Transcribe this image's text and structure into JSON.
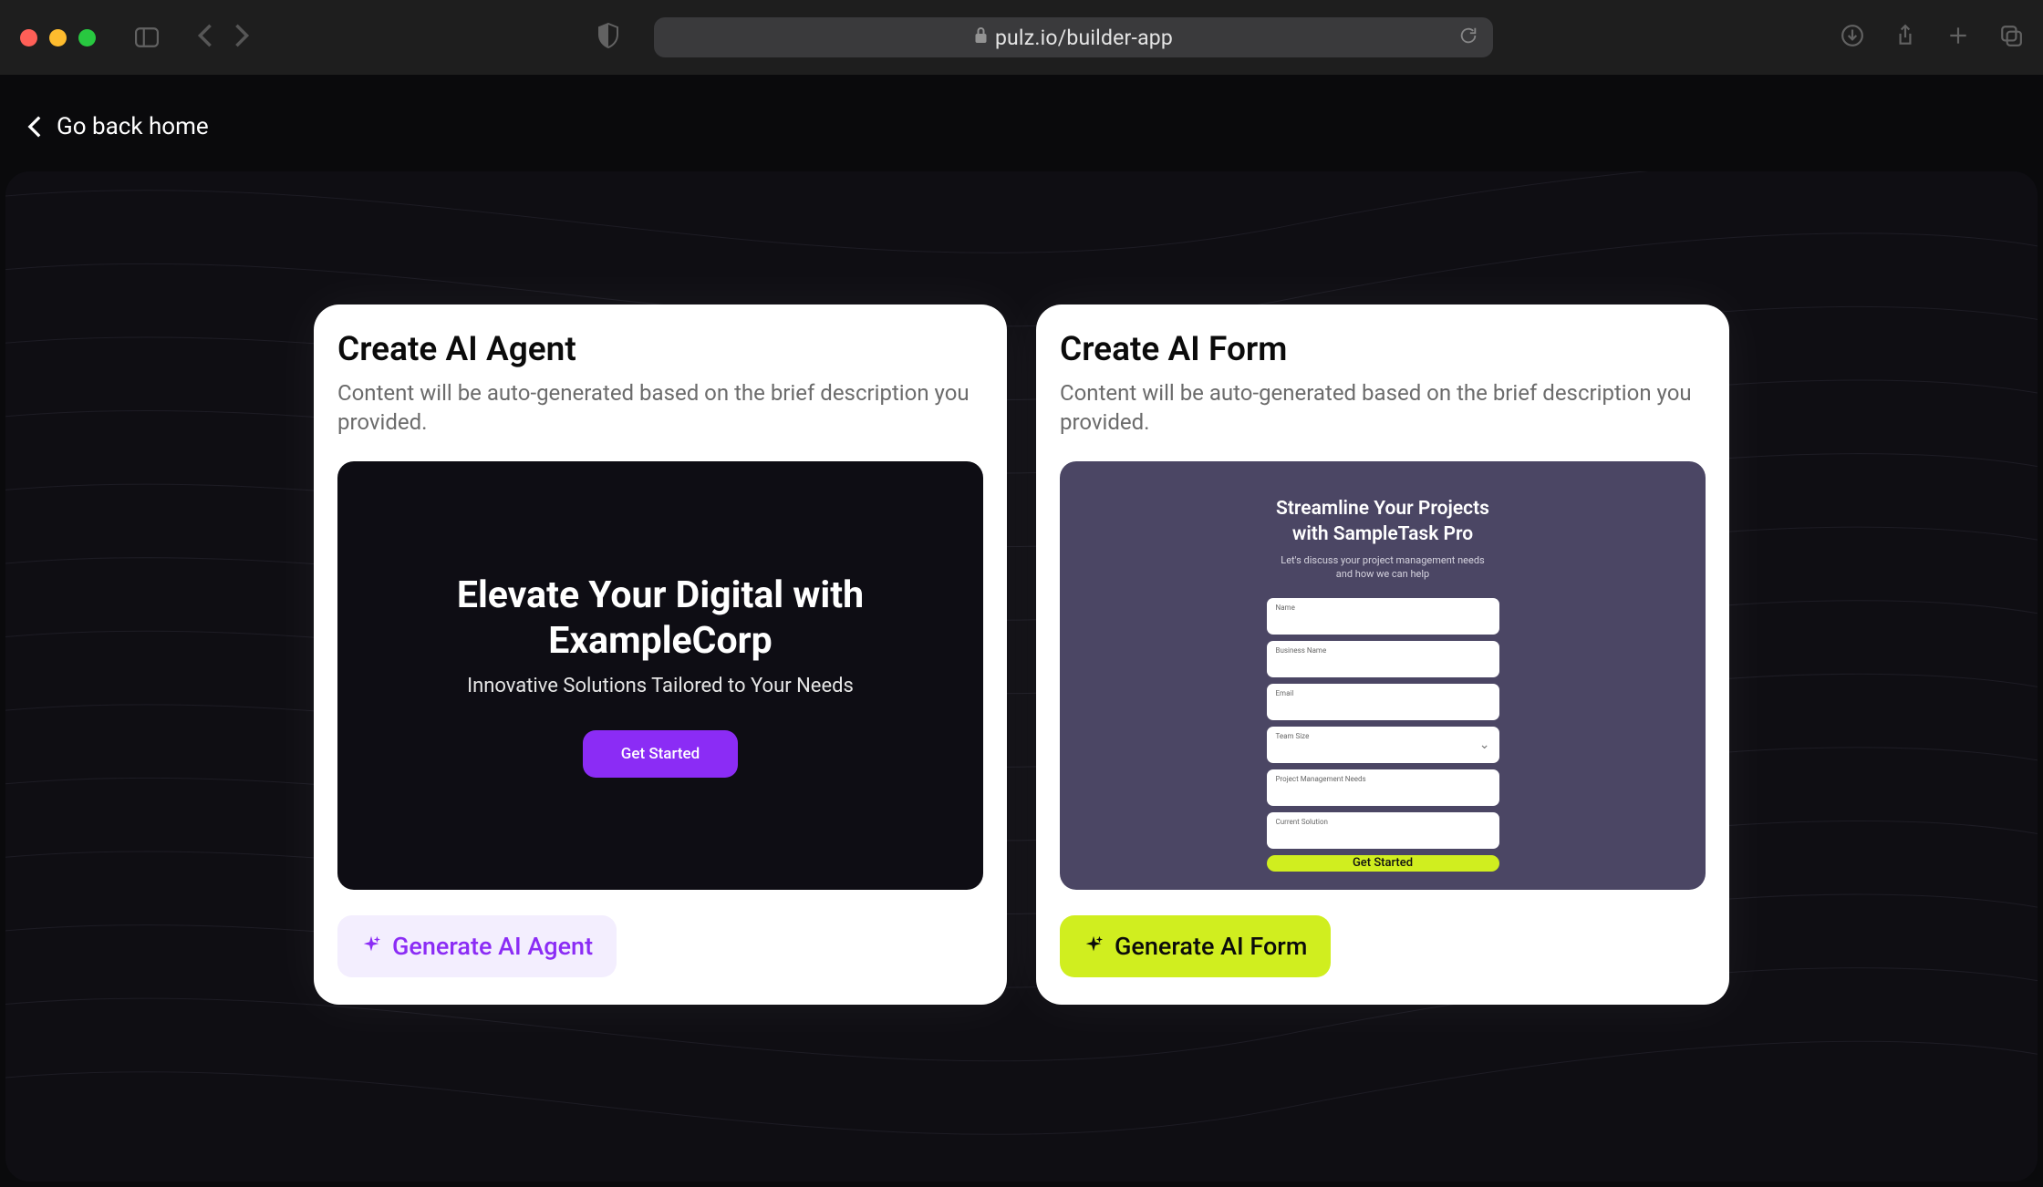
{
  "browser": {
    "url_display": "pulz.io/builder-app"
  },
  "back_link": "Go back home",
  "cards": {
    "agent": {
      "title": "Create AI Agent",
      "desc": "Content will be auto-generated based on the brief description you provided.",
      "preview": {
        "hero_title": "Elevate Your Digital with ExampleCorp",
        "hero_sub": "Innovative Solutions Tailored to Your Needs",
        "cta": "Get Started"
      },
      "button": "Generate AI Agent"
    },
    "form": {
      "title": "Create AI Form",
      "desc": "Content will be auto-generated based on the brief description you provided.",
      "preview": {
        "form_title_l1": "Streamline Your Projects",
        "form_title_l2": "with SampleTask Pro",
        "form_sub_l1": "Let's discuss your project management needs",
        "form_sub_l2": "and how we can help",
        "fields": {
          "0": "Name",
          "1": "Business Name",
          "2": "Email",
          "3": "Team Size",
          "4": "Project Management Needs",
          "5": "Current Solution"
        },
        "cta": "Get Started"
      },
      "button": "Generate AI Form"
    }
  },
  "colors": {
    "accent_purple": "#8b2cf5",
    "accent_lime": "#d0ee1f",
    "card_preview_dark": "#0e0d14",
    "card_preview_slate": "#4b4664"
  }
}
